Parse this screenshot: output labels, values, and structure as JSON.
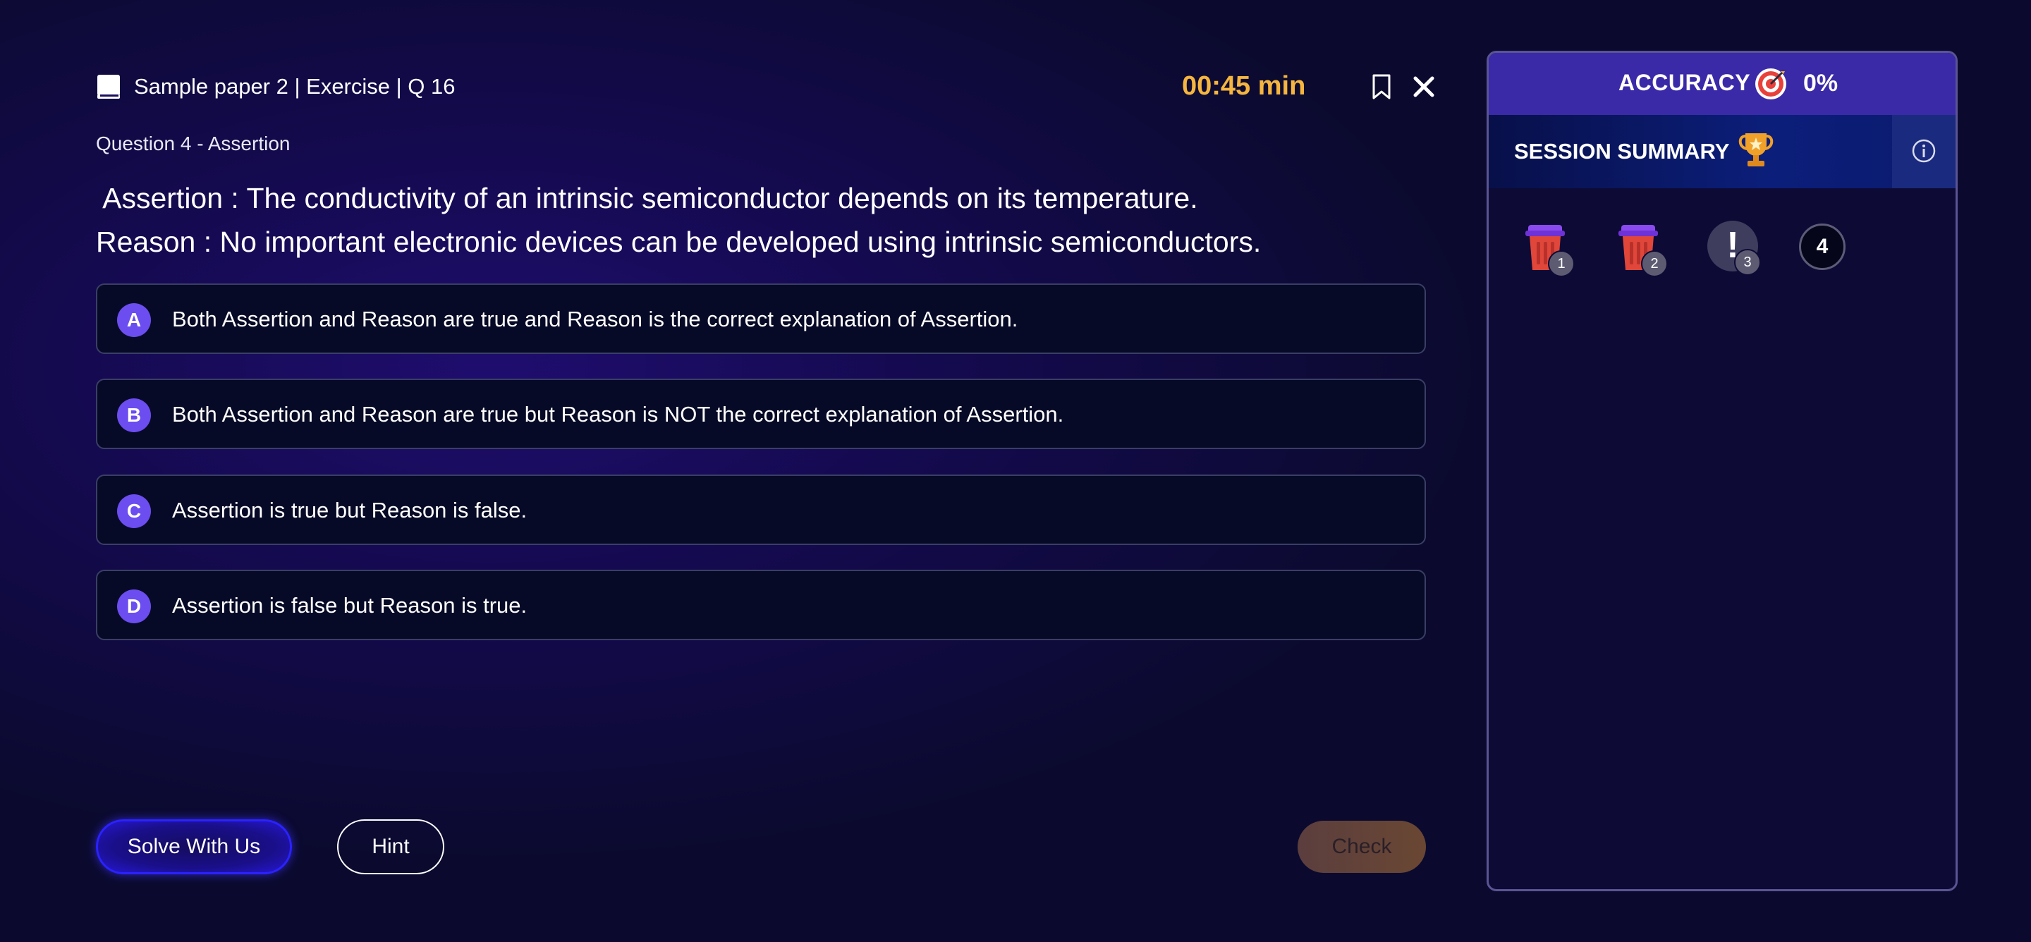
{
  "header": {
    "breadcrumb": "Sample paper 2 | Exercise | Q 16",
    "timer": "00:45 min",
    "bookmark_icon": "bookmark-icon",
    "close_icon": "close-icon"
  },
  "question": {
    "label": "Question 4 - Assertion",
    "assertion": " Assertion : The conductivity of an intrinsic semiconductor depends on its temperature.",
    "reason": "Reason : No important electronic devices can be developed using intrinsic semiconductors."
  },
  "options": [
    {
      "letter": "A",
      "text": "Both Assertion and Reason are true and Reason is the correct explanation of Assertion."
    },
    {
      "letter": "B",
      "text": "Both Assertion and Reason are true but Reason is NOT the correct explanation of Assertion."
    },
    {
      "letter": "C",
      "text": "Assertion is true but Reason is false."
    },
    {
      "letter": "D",
      "text": "Assertion is false but Reason is true."
    }
  ],
  "actions": {
    "solve_label": "Solve With Us",
    "hint_label": "Hint",
    "check_label": "Check"
  },
  "panel": {
    "accuracy_label": "ACCURACY",
    "accuracy_value": "0%",
    "session_label": "SESSION SUMMARY",
    "questions": [
      {
        "number": "1",
        "status": "wrong",
        "icon": "trash-icon"
      },
      {
        "number": "2",
        "status": "wrong",
        "icon": "trash-icon"
      },
      {
        "number": "3",
        "status": "skipped",
        "icon": "exclamation-icon"
      },
      {
        "number": "4",
        "status": "current"
      }
    ]
  },
  "colors": {
    "accent": "#6b4df0",
    "timer": "#f5b53f",
    "accuracy_bar": "#3a2aa8",
    "wrong": "#e0463a"
  }
}
